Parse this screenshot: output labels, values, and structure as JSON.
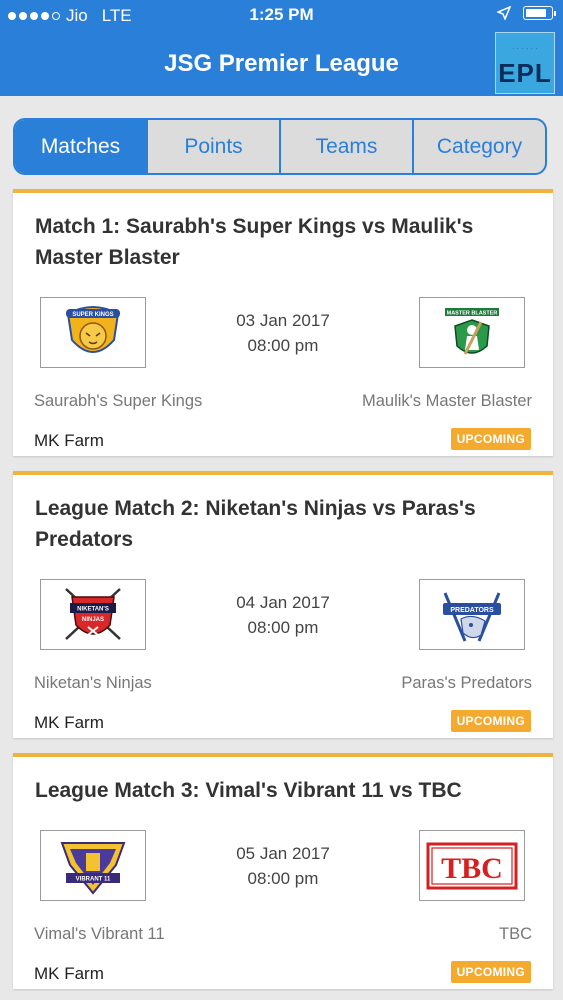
{
  "status_bar": {
    "carrier": "Jio",
    "network": "LTE",
    "time": "1:25 PM"
  },
  "header": {
    "title": "JSG Premier League",
    "logo_text": "EPL"
  },
  "tabs": [
    {
      "label": "Matches",
      "active": true
    },
    {
      "label": "Points",
      "active": false
    },
    {
      "label": "Teams",
      "active": false
    },
    {
      "label": "Category",
      "active": false
    }
  ],
  "matches": [
    {
      "title": "Match 1: Saurabh's Super Kings vs Maulik's Master Blaster",
      "date": "03 Jan 2017",
      "time": "08:00 pm",
      "team_a": {
        "name": "Saurabh's Super Kings",
        "logo_text": "SAURABH'S SUPER KINGS"
      },
      "team_b": {
        "name": "Maulik's Master Blaster",
        "logo_text": "MAULIK'S MASTER BLASTER"
      },
      "venue": "MK Farm",
      "status": "UPCOMING"
    },
    {
      "title": "League Match 2: Niketan's Ninjas vs Paras's Predators",
      "date": "04 Jan 2017",
      "time": "08:00 pm",
      "team_a": {
        "name": "Niketan's Ninjas",
        "logo_text": "NIKETAN'S NINJAS"
      },
      "team_b": {
        "name": "Paras's Predators",
        "logo_text": "PARAS'S PREDATORS"
      },
      "venue": "MK Farm",
      "status": "UPCOMING"
    },
    {
      "title": "League Match 3: Vimal's Vibrant 11 vs TBC",
      "date": "05 Jan 2017",
      "time": "08:00 pm",
      "team_a": {
        "name": "Vimal's Vibrant 11",
        "logo_text": "VIMAL'S VIBRANT 11"
      },
      "team_b": {
        "name": "TBC",
        "logo_text": "TBC"
      },
      "venue": "MK Farm",
      "status": "UPCOMING"
    }
  ],
  "colors": {
    "primary": "#2a7fd8",
    "accent": "#f0b340",
    "badge": "#f4a92f"
  }
}
